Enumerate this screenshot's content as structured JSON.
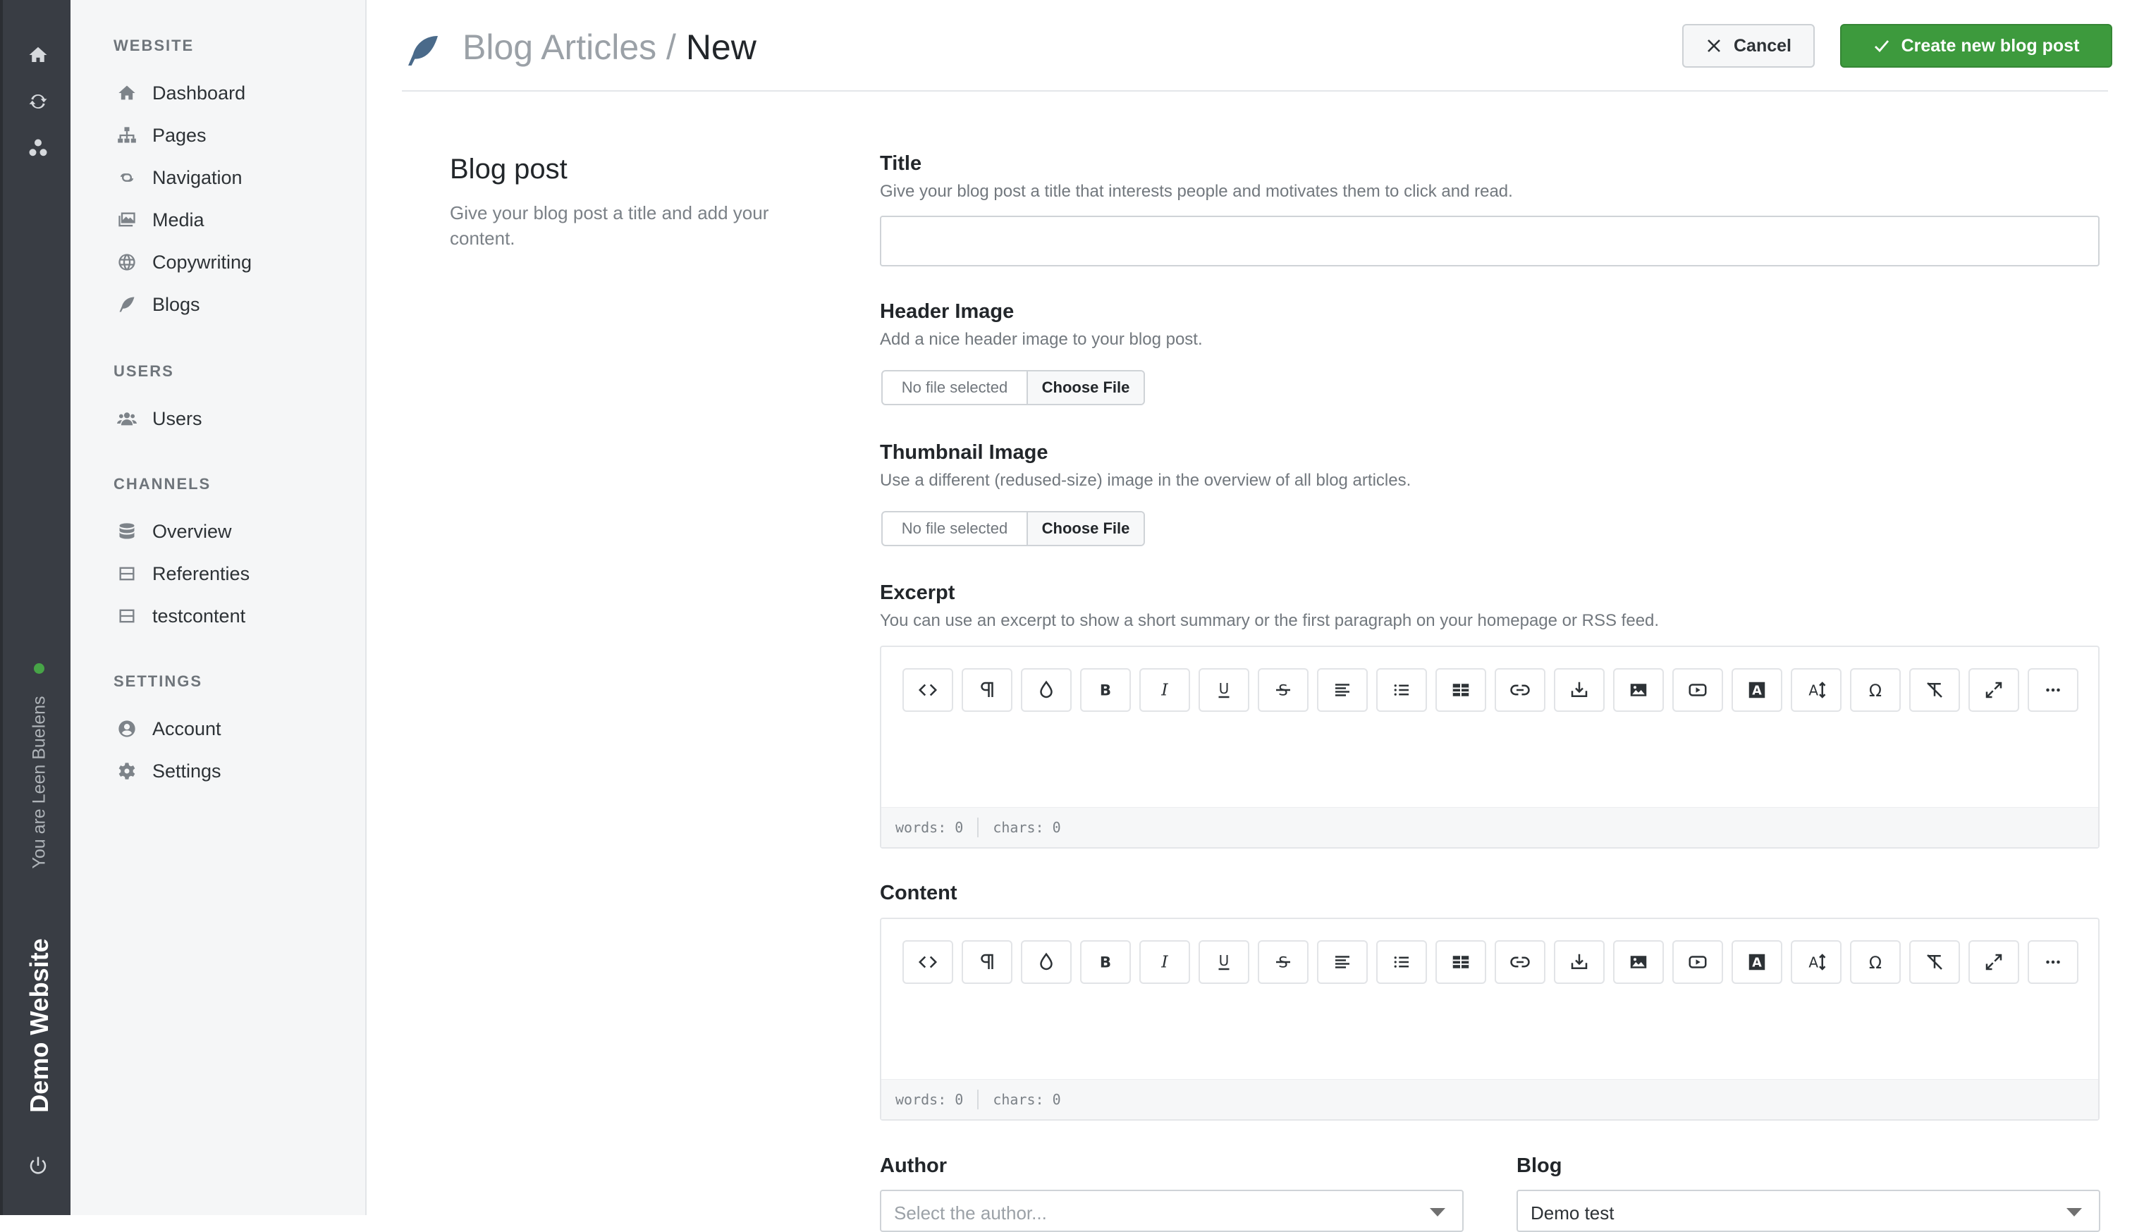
{
  "rail": {
    "icons": [
      "home-icon",
      "sync-icon",
      "sitemap-icon"
    ],
    "status_color": "#47a447",
    "user_text": "You are Leen Buelens",
    "site_name": "Demo Website",
    "power_icon": "power-icon"
  },
  "sidebar": {
    "sections": [
      {
        "title": "WEBSITE",
        "items": [
          {
            "label": "Dashboard",
            "icon": "home-icon"
          },
          {
            "label": "Pages",
            "icon": "sitemap-icon"
          },
          {
            "label": "Navigation",
            "icon": "link-icon"
          },
          {
            "label": "Media",
            "icon": "images-icon"
          },
          {
            "label": "Copywriting",
            "icon": "globe-icon"
          },
          {
            "label": "Blogs",
            "icon": "feather-icon"
          }
        ]
      },
      {
        "title": "USERS",
        "items": [
          {
            "label": "Users",
            "icon": "users-icon"
          }
        ]
      },
      {
        "title": "CHANNELS",
        "items": [
          {
            "label": "Overview",
            "icon": "database-icon"
          },
          {
            "label": "Referenties",
            "icon": "window-icon"
          },
          {
            "label": "testcontent",
            "icon": "window-icon"
          }
        ]
      },
      {
        "title": "SETTINGS",
        "items": [
          {
            "label": "Account",
            "icon": "user-circle-icon"
          },
          {
            "label": "Settings",
            "icon": "gear-icon"
          }
        ]
      }
    ]
  },
  "header": {
    "icon": "feather-icon",
    "breadcrumb_parent": "Blog Articles /",
    "breadcrumb_current": "New",
    "cancel_label": "Cancel",
    "create_label": "Create new blog post"
  },
  "intro": {
    "title": "Blog post",
    "description": "Give your blog post a title and add your content."
  },
  "fields": {
    "title": {
      "label": "Title",
      "help": "Give your blog post a title that interests people and motivates them to click and read.",
      "value": ""
    },
    "header_image": {
      "label": "Header Image",
      "help": "Add a nice header image to your blog post.",
      "status": "No file selected",
      "button": "Choose File"
    },
    "thumbnail_image": {
      "label": "Thumbnail Image",
      "help": "Use a different (redused-size) image in the overview of all blog articles.",
      "status": "No file selected",
      "button": "Choose File"
    },
    "excerpt": {
      "label": "Excerpt",
      "help": "You can use an excerpt to show a short summary or the first paragraph on your homepage or RSS feed.",
      "words": "words: 0",
      "chars": "chars: 0"
    },
    "content": {
      "label": "Content",
      "words": "words: 0",
      "chars": "chars: 0"
    },
    "author": {
      "label": "Author",
      "placeholder": "Select the author..."
    },
    "blog": {
      "label": "Blog",
      "value": "Demo test"
    }
  },
  "toolbar_buttons": [
    "code-view-icon",
    "paragraph-icon",
    "color-icon",
    "bold-icon",
    "italic-icon",
    "underline-icon",
    "strikethrough-icon",
    "align-icon",
    "list-icon",
    "table-icon",
    "link-icon",
    "upload-icon",
    "image-icon",
    "video-icon",
    "font-color-icon",
    "font-size-icon",
    "special-char-icon",
    "clear-format-icon",
    "fullscreen-icon",
    "more-icon"
  ]
}
